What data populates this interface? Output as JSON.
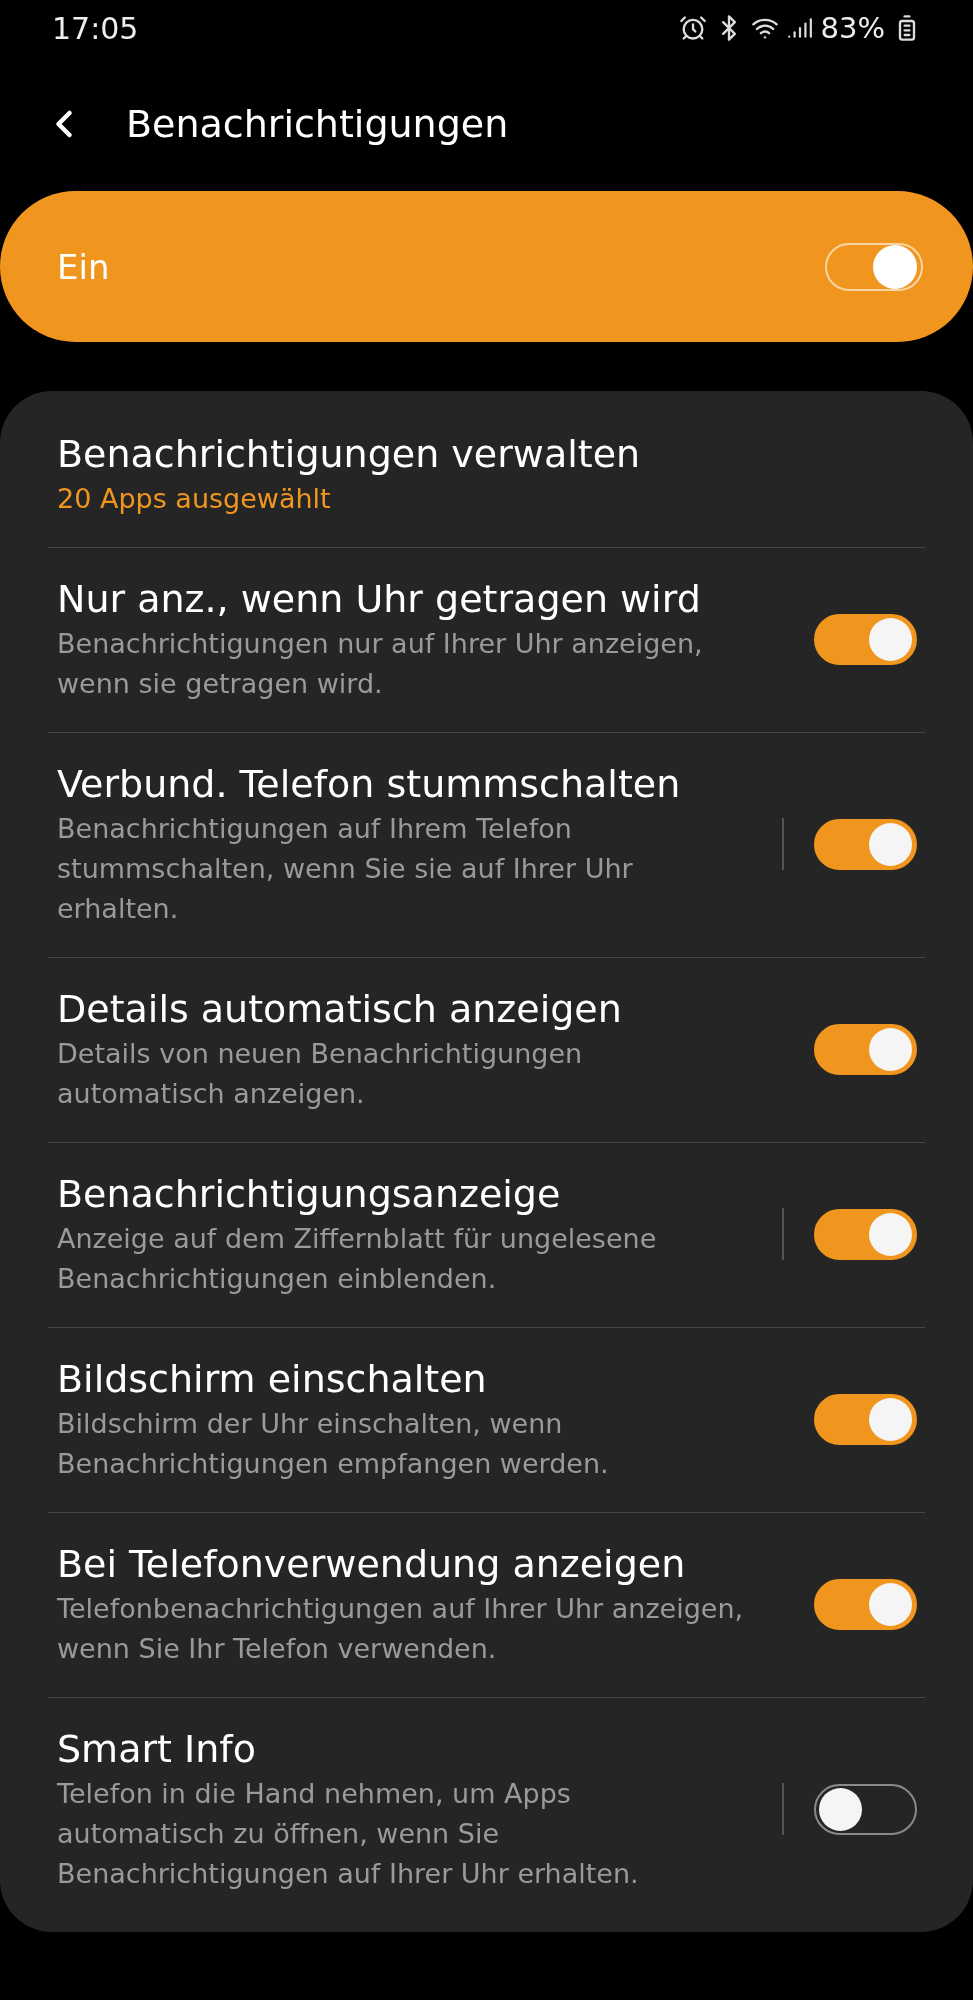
{
  "status_bar": {
    "time": "17:05",
    "battery": "83%"
  },
  "header": {
    "title": "Benachrichtigungen"
  },
  "master": {
    "label": "Ein",
    "on": true
  },
  "items": [
    {
      "kind": "link",
      "title": "Benachrichtigungen verwalten",
      "subtitle": "20 Apps ausgewählt"
    },
    {
      "kind": "toggle",
      "title": "Nur anz., wenn Uhr getragen wird",
      "subtitle": "Benachrichtigungen nur auf Ihrer Uhr anzeigen, wenn sie getragen wird.",
      "on": true,
      "separator": false
    },
    {
      "kind": "toggle",
      "title": "Verbund. Telefon stummschalten",
      "subtitle": "Benachrichtigungen auf Ihrem Telefon stummschalten, wenn Sie sie auf Ihrer Uhr erhalten.",
      "on": true,
      "separator": true
    },
    {
      "kind": "toggle",
      "title": "Details automatisch anzeigen",
      "subtitle": "Details von neuen Benachrichtigungen automatisch anzeigen.",
      "on": true,
      "separator": false
    },
    {
      "kind": "toggle",
      "title": "Benachrichtigungsanzeige",
      "subtitle": "Anzeige auf dem Ziffernblatt für ungelesene Benachrichtigungen einblenden.",
      "on": true,
      "separator": true
    },
    {
      "kind": "toggle",
      "title": "Bildschirm einschalten",
      "subtitle": "Bildschirm der Uhr einschalten, wenn Benachrichtigungen empfangen werden.",
      "on": true,
      "separator": false
    },
    {
      "kind": "toggle",
      "title": "Bei Telefonverwendung anzeigen",
      "subtitle": "Telefonbenachrichtigungen auf Ihrer Uhr anzeigen, wenn Sie Ihr Telefon verwenden.",
      "on": true,
      "separator": false
    },
    {
      "kind": "toggle",
      "title": "Smart Info",
      "subtitle": "Telefon in die Hand nehmen, um Apps automatisch zu öffnen, wenn Sie Benachrichtigungen auf Ihrer Uhr erhalten.",
      "on": false,
      "separator": true
    }
  ]
}
